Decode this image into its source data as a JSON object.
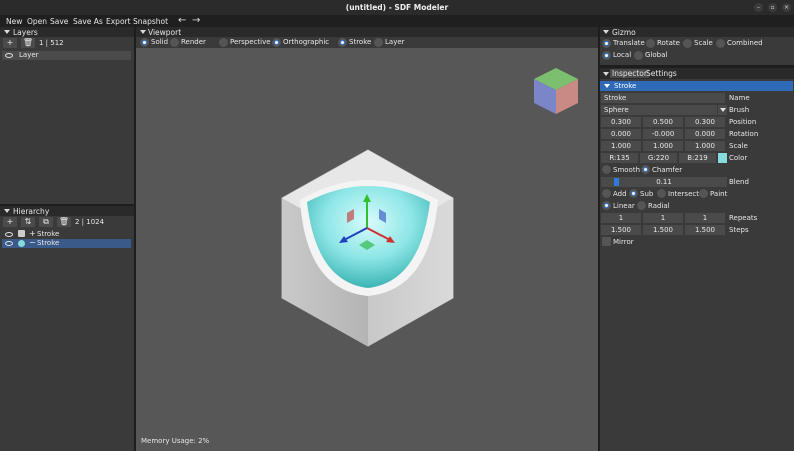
{
  "window": {
    "title": "(untitled) - SDF Modeler"
  },
  "menu": {
    "items": [
      "New",
      "Open",
      "Save",
      "Save As",
      "Export",
      "Snapshot"
    ]
  },
  "layers": {
    "title": "Layers",
    "count": "1 | 512",
    "items": [
      {
        "name": "Layer"
      }
    ]
  },
  "hierarchy": {
    "title": "Hierarchy",
    "count": "2 | 1024",
    "items": [
      {
        "name": "Stroke",
        "op": "+",
        "selected": false
      },
      {
        "name": "Stroke",
        "op": "−",
        "selected": true
      }
    ]
  },
  "viewport": {
    "title": "Viewport",
    "options": [
      "Solid",
      "Render",
      "Perspective",
      "Orthographic",
      "Stroke",
      "Layer"
    ],
    "memory": "Memory Usage: 2%"
  },
  "gizmo": {
    "title": "Gizmo",
    "modes": [
      "Translate",
      "Rotate",
      "Scale",
      "Combined"
    ],
    "space": [
      "Local",
      "Global"
    ]
  },
  "inspector": {
    "tabs": [
      "Inspector",
      "Settings"
    ],
    "section": "Stroke",
    "name_value": "Stroke",
    "name_label": "Name",
    "brush_value": "Sphere",
    "brush_label": "Brush",
    "position": [
      "0.300",
      "0.500",
      "0.300"
    ],
    "position_label": "Position",
    "rotation": [
      "0.000",
      "-0.000",
      "0.000"
    ],
    "rotation_label": "Rotation",
    "scale": [
      "1.000",
      "1.000",
      "1.000"
    ],
    "scale_label": "Scale",
    "color": [
      "R:135",
      "G:220",
      "B:219"
    ],
    "color_label": "Color",
    "color_hex": "#87dcdb",
    "smooth": "Smooth",
    "chamfer": "Chamfer",
    "blend_value": "0.11",
    "blend_fraction": 0.1,
    "blend_label": "Blend",
    "ops": [
      "Add",
      "Sub",
      "Intersect",
      "Paint"
    ],
    "falloff": [
      "Linear",
      "Radial"
    ],
    "repeats": [
      "1",
      "1",
      "1"
    ],
    "repeats_label": "Repeats",
    "steps": [
      "1.500",
      "1.500",
      "1.500"
    ],
    "steps_label": "Steps",
    "mirror": "Mirror"
  },
  "colors": {
    "accent": "#2e7bdc",
    "selection": "#3a5a8a",
    "panel": "#3a3a3a",
    "viewport_bg": "#575757",
    "axis_x": "#d03030",
    "axis_y": "#30c030",
    "axis_z": "#3060e0"
  }
}
